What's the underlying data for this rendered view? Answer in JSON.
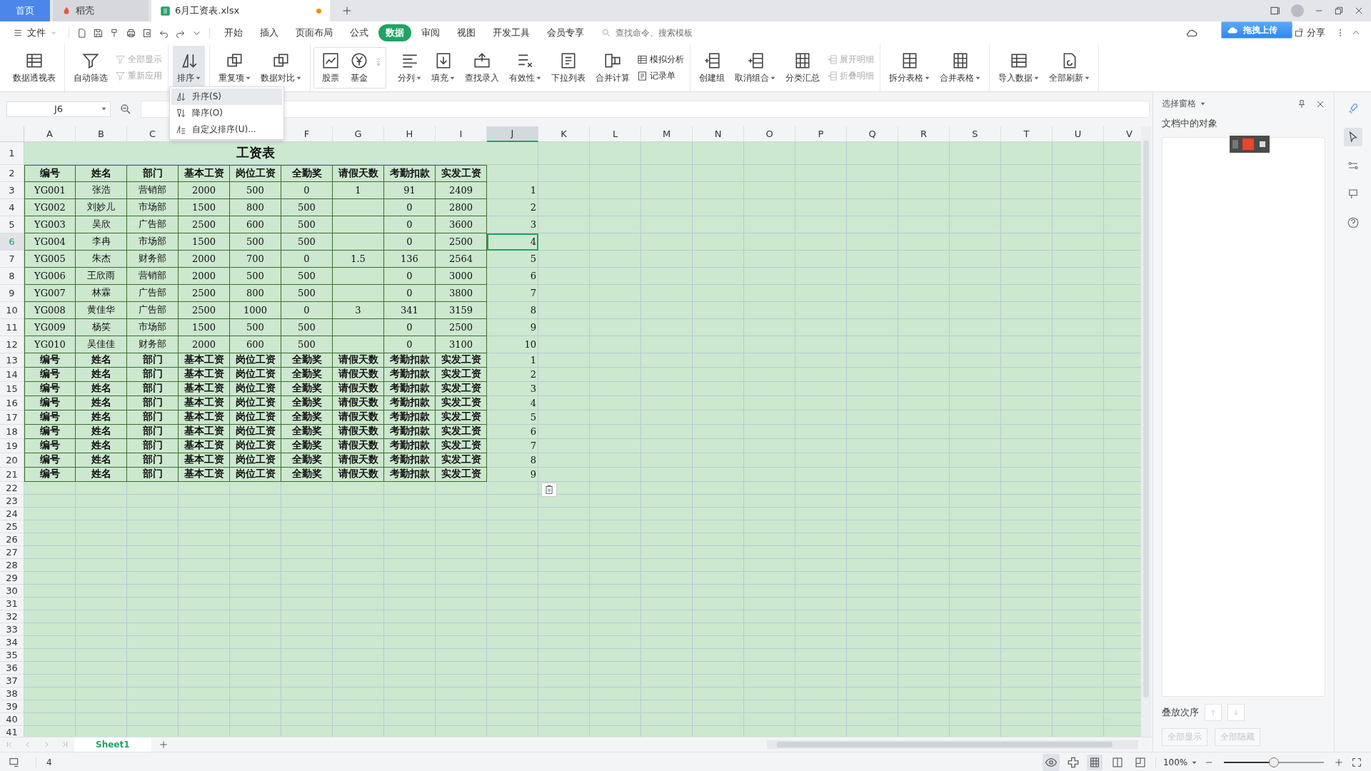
{
  "tabs": [
    {
      "label": "首页",
      "selected": false,
      "kind": "home",
      "modified": false
    },
    {
      "label": "稻壳",
      "selected": false,
      "kind": "app",
      "modified": false
    },
    {
      "label": "6月工资表.xlsx",
      "selected": true,
      "kind": "file",
      "modified": true
    }
  ],
  "menu": {
    "file_label": "文件",
    "tabs": [
      {
        "label": "开始",
        "selected": false
      },
      {
        "label": "插入",
        "selected": false
      },
      {
        "label": "页面布局",
        "selected": false
      },
      {
        "label": "公式",
        "selected": false
      },
      {
        "label": "数据",
        "selected": true
      },
      {
        "label": "审阅",
        "selected": false
      },
      {
        "label": "视图",
        "selected": false
      },
      {
        "label": "开发工具",
        "selected": false
      },
      {
        "label": "会员专享",
        "selected": false
      }
    ],
    "search": {
      "placeholder": "查找命令、搜索模板"
    },
    "share_label": "分享"
  },
  "upload_overlay": {
    "label": "拖拽上传"
  },
  "ribbon": {
    "groups": [
      {
        "kind": "plain",
        "items": [
          {
            "kind": "large",
            "label": "数据透视表",
            "dropdown": false,
            "disabled": false,
            "expanded": false
          }
        ]
      },
      {
        "kind": "plain",
        "items": [
          {
            "kind": "large",
            "label": "自动筛选",
            "dropdown": false,
            "disabled": false,
            "expanded": false
          },
          {
            "kind": "small",
            "label": "全部显示",
            "dropdown": false,
            "disabled": true,
            "expanded": false
          },
          {
            "kind": "small",
            "label": "重新应用",
            "dropdown": false,
            "disabled": true,
            "expanded": false
          }
        ]
      },
      {
        "kind": "plain",
        "items": [
          {
            "kind": "large",
            "label": "排序",
            "dropdown": true,
            "disabled": false,
            "expanded": true
          }
        ]
      },
      {
        "kind": "plain",
        "items": [
          {
            "kind": "large",
            "label": "重复项",
            "dropdown": true,
            "disabled": false,
            "expanded": false
          },
          {
            "kind": "large",
            "label": "数据对比",
            "dropdown": true,
            "disabled": false,
            "expanded": false
          }
        ]
      },
      {
        "kind": "gallery",
        "items": [
          {
            "kind": "large",
            "label": "股票",
            "dropdown": false,
            "disabled": false,
            "expanded": false
          },
          {
            "kind": "large",
            "label": "基金",
            "dropdown": false,
            "disabled": false,
            "expanded": false
          }
        ]
      },
      {
        "kind": "plain",
        "items": [
          {
            "kind": "large",
            "label": "分列",
            "dropdown": true,
            "disabled": false,
            "expanded": false
          },
          {
            "kind": "large",
            "label": "填充",
            "dropdown": true,
            "disabled": false,
            "expanded": false
          },
          {
            "kind": "large",
            "label": "查找录入",
            "dropdown": false,
            "disabled": false,
            "expanded": false
          },
          {
            "kind": "large",
            "label": "有效性",
            "dropdown": true,
            "disabled": false,
            "expanded": false
          },
          {
            "kind": "large",
            "label": "下拉列表",
            "dropdown": false,
            "disabled": false,
            "expanded": false
          },
          {
            "kind": "large",
            "label": "合并计算",
            "dropdown": false,
            "disabled": false,
            "expanded": false
          },
          {
            "kind": "small",
            "label": "模拟分析",
            "dropdown": false,
            "disabled": false,
            "expanded": false
          },
          {
            "kind": "small",
            "label": "记录单",
            "dropdown": false,
            "disabled": false,
            "expanded": false
          }
        ]
      },
      {
        "kind": "plain",
        "items": [
          {
            "kind": "large",
            "label": "创建组",
            "dropdown": false,
            "disabled": false,
            "expanded": false
          },
          {
            "kind": "large",
            "label": "取消组合",
            "dropdown": true,
            "disabled": false,
            "expanded": false
          },
          {
            "kind": "large",
            "label": "分类汇总",
            "dropdown": false,
            "disabled": false,
            "expanded": false
          },
          {
            "kind": "small",
            "label": "展开明细",
            "dropdown": false,
            "disabled": true,
            "expanded": false
          },
          {
            "kind": "small",
            "label": "折叠明细",
            "dropdown": false,
            "disabled": true,
            "expanded": false
          }
        ]
      },
      {
        "kind": "plain",
        "items": [
          {
            "kind": "large",
            "label": "拆分表格",
            "dropdown": true,
            "disabled": false,
            "expanded": false
          },
          {
            "kind": "large",
            "label": "合并表格",
            "dropdown": true,
            "disabled": false,
            "expanded": false
          }
        ]
      },
      {
        "kind": "plain",
        "items": [
          {
            "kind": "large",
            "label": "导入数据",
            "dropdown": true,
            "disabled": false,
            "expanded": false
          },
          {
            "kind": "large",
            "label": "全部刷新",
            "dropdown": true,
            "disabled": false,
            "expanded": false
          }
        ]
      }
    ]
  },
  "sort_menu": {
    "items": [
      {
        "label": "升序(S)",
        "selected": true
      },
      {
        "label": "降序(O)",
        "selected": false
      },
      {
        "label": "自定义排序(U)...",
        "selected": false
      }
    ]
  },
  "formula_bar": {
    "name_box": "J6"
  },
  "sheet": {
    "columns": [
      {
        "label": "A",
        "selected": false
      },
      {
        "label": "B",
        "selected": false
      },
      {
        "label": "C",
        "selected": false
      },
      {
        "selected": false
      },
      {
        "selected": false
      },
      {
        "label": "F",
        "selected": false
      },
      {
        "label": "G",
        "selected": false
      },
      {
        "label": "H",
        "selected": false
      },
      {
        "label": "I",
        "selected": false
      },
      {
        "label": "J",
        "selected": true
      },
      {
        "label": "K",
        "selected": false
      },
      {
        "label": "L",
        "selected": false
      },
      {
        "label": "M",
        "selected": false
      },
      {
        "label": "N",
        "selected": false
      },
      {
        "label": "O",
        "selected": false
      },
      {
        "label": "P",
        "selected": false
      },
      {
        "label": "Q",
        "selected": false
      },
      {
        "label": "R",
        "selected": false
      },
      {
        "label": "S",
        "selected": false
      },
      {
        "label": "T",
        "selected": false
      },
      {
        "label": "U",
        "selected": false
      },
      {
        "label": "V",
        "selected": false
      }
    ],
    "rows": [
      {
        "number": "1",
        "selected": false,
        "kind": "title",
        "cells": {
          "A": "工资表"
        }
      },
      {
        "number": "2",
        "selected": false,
        "kind": "header",
        "cells": {
          "A": "编号",
          "B": "姓名",
          "C": "部门",
          "D": "基本工资",
          "E": "岗位工资",
          "F": "全勤奖",
          "G": "请假天数",
          "H": "考勤扣款",
          "I": "实发工资"
        }
      },
      {
        "number": "3",
        "selected": false,
        "kind": "data",
        "cells": {
          "A": "YG001",
          "B": "张浩",
          "C": "营销部",
          "D": "2000",
          "E": "500",
          "F": "0",
          "G": "1",
          "H": "91",
          "I": "2409",
          "J": "1"
        }
      },
      {
        "number": "4",
        "selected": false,
        "kind": "data",
        "cells": {
          "A": "YG002",
          "B": "刘妙儿",
          "C": "市场部",
          "D": "1500",
          "E": "800",
          "F": "500",
          "H": "0",
          "I": "2800",
          "J": "2"
        }
      },
      {
        "number": "5",
        "selected": false,
        "kind": "data",
        "cells": {
          "A": "YG003",
          "B": "吴欣",
          "C": "广告部",
          "D": "2500",
          "E": "600",
          "F": "500",
          "H": "0",
          "I": "3600",
          "J": "3"
        }
      },
      {
        "number": "6",
        "selected": true,
        "kind": "data",
        "cells": {
          "A": "YG004",
          "B": "李冉",
          "C": "市场部",
          "D": "1500",
          "E": "500",
          "F": "500",
          "H": "0",
          "I": "2500",
          "J": "4"
        }
      },
      {
        "number": "7",
        "selected": false,
        "kind": "data",
        "cells": {
          "A": "YG005",
          "B": "朱杰",
          "C": "财务部",
          "D": "2000",
          "E": "700",
          "F": "0",
          "G": "1.5",
          "H": "136",
          "I": "2564",
          "J": "5"
        }
      },
      {
        "number": "8",
        "selected": false,
        "kind": "data",
        "cells": {
          "A": "YG006",
          "B": "王欣雨",
          "C": "营销部",
          "D": "2000",
          "E": "500",
          "F": "500",
          "H": "0",
          "I": "3000",
          "J": "6"
        }
      },
      {
        "number": "9",
        "selected": false,
        "kind": "data",
        "cells": {
          "A": "YG007",
          "B": "林霖",
          "C": "广告部",
          "D": "2500",
          "E": "800",
          "F": "500",
          "H": "0",
          "I": "3800",
          "J": "7"
        }
      },
      {
        "number": "10",
        "selected": false,
        "kind": "data",
        "cells": {
          "A": "YG008",
          "B": "黄佳华",
          "C": "广告部",
          "D": "2500",
          "E": "1000",
          "F": "0",
          "G": "3",
          "H": "341",
          "I": "3159",
          "J": "8"
        }
      },
      {
        "number": "11",
        "selected": false,
        "kind": "data",
        "cells": {
          "A": "YG009",
          "B": "杨笑",
          "C": "市场部",
          "D": "1500",
          "E": "500",
          "F": "500",
          "H": "0",
          "I": "2500",
          "J": "9"
        }
      },
      {
        "number": "12",
        "selected": false,
        "kind": "data",
        "cells": {
          "A": "YG010",
          "B": "吴佳佳",
          "C": "财务部",
          "D": "2000",
          "E": "600",
          "F": "500",
          "H": "0",
          "I": "3100",
          "J": "10"
        }
      },
      {
        "number": "13",
        "selected": false,
        "kind": "repeat",
        "cells": {
          "A": "编号",
          "B": "姓名",
          "C": "部门",
          "D": "基本工资",
          "E": "岗位工资",
          "F": "全勤奖",
          "G": "请假天数",
          "H": "考勤扣款",
          "I": "实发工资",
          "J": "1"
        }
      },
      {
        "number": "14",
        "selected": false,
        "kind": "repeat",
        "cells": {
          "A": "编号",
          "B": "姓名",
          "C": "部门",
          "D": "基本工资",
          "E": "岗位工资",
          "F": "全勤奖",
          "G": "请假天数",
          "H": "考勤扣款",
          "I": "实发工资",
          "J": "2"
        }
      },
      {
        "number": "15",
        "selected": false,
        "kind": "repeat",
        "cells": {
          "A": "编号",
          "B": "姓名",
          "C": "部门",
          "D": "基本工资",
          "E": "岗位工资",
          "F": "全勤奖",
          "G": "请假天数",
          "H": "考勤扣款",
          "I": "实发工资",
          "J": "3"
        }
      },
      {
        "number": "16",
        "selected": false,
        "kind": "repeat",
        "cells": {
          "A": "编号",
          "B": "姓名",
          "C": "部门",
          "D": "基本工资",
          "E": "岗位工资",
          "F": "全勤奖",
          "G": "请假天数",
          "H": "考勤扣款",
          "I": "实发工资",
          "J": "4"
        }
      },
      {
        "number": "17",
        "selected": false,
        "kind": "repeat",
        "cells": {
          "A": "编号",
          "B": "姓名",
          "C": "部门",
          "D": "基本工资",
          "E": "岗位工资",
          "F": "全勤奖",
          "G": "请假天数",
          "H": "考勤扣款",
          "I": "实发工资",
          "J": "5"
        }
      },
      {
        "number": "18",
        "selected": false,
        "kind": "repeat",
        "cells": {
          "A": "编号",
          "B": "姓名",
          "C": "部门",
          "D": "基本工资",
          "E": "岗位工资",
          "F": "全勤奖",
          "G": "请假天数",
          "H": "考勤扣款",
          "I": "实发工资",
          "J": "6"
        }
      },
      {
        "number": "19",
        "selected": false,
        "kind": "repeat",
        "cells": {
          "A": "编号",
          "B": "姓名",
          "C": "部门",
          "D": "基本工资",
          "E": "岗位工资",
          "F": "全勤奖",
          "G": "请假天数",
          "H": "考勤扣款",
          "I": "实发工资",
          "J": "7"
        }
      },
      {
        "number": "20",
        "selected": false,
        "kind": "repeat",
        "cells": {
          "A": "编号",
          "B": "姓名",
          "C": "部门",
          "D": "基本工资",
          "E": "岗位工资",
          "F": "全勤奖",
          "G": "请假天数",
          "H": "考勤扣款",
          "I": "实发工资",
          "J": "8"
        }
      },
      {
        "number": "21",
        "selected": false,
        "kind": "repeat",
        "cells": {
          "A": "编号",
          "B": "姓名",
          "C": "部门",
          "D": "基本工资",
          "E": "岗位工资",
          "F": "全勤奖",
          "G": "请假天数",
          "H": "考勤扣款",
          "I": "实发工资",
          "J": "9"
        }
      },
      {
        "number": "22",
        "selected": false,
        "kind": "empty"
      },
      {
        "number": "23",
        "selected": false,
        "kind": "empty"
      },
      {
        "number": "24",
        "selected": false,
        "kind": "empty"
      },
      {
        "number": "25",
        "selected": false,
        "kind": "empty"
      },
      {
        "number": "26",
        "selected": false,
        "kind": "empty"
      },
      {
        "number": "27",
        "selected": false,
        "kind": "empty"
      },
      {
        "number": "28",
        "selected": false,
        "kind": "empty"
      },
      {
        "number": "29",
        "selected": false,
        "kind": "empty"
      },
      {
        "number": "30",
        "selected": false,
        "kind": "empty"
      },
      {
        "number": "31",
        "selected": false,
        "kind": "empty"
      },
      {
        "number": "32",
        "selected": false,
        "kind": "empty"
      },
      {
        "number": "33",
        "selected": false,
        "kind": "empty"
      },
      {
        "number": "34",
        "selected": false,
        "kind": "empty"
      },
      {
        "number": "35",
        "selected": false,
        "kind": "empty"
      },
      {
        "number": "36",
        "selected": false,
        "kind": "empty"
      },
      {
        "number": "37",
        "selected": false,
        "kind": "empty"
      },
      {
        "number": "38",
        "selected": false,
        "kind": "empty"
      },
      {
        "number": "39",
        "selected": false,
        "kind": "empty"
      },
      {
        "number": "40",
        "selected": false,
        "kind": "empty"
      },
      {
        "number": "41",
        "selected": false,
        "kind": "empty"
      }
    ]
  },
  "sheet_tabs": [
    {
      "label": "Sheet1",
      "selected": true
    }
  ],
  "selection_pane": {
    "title": "选择窗格",
    "objects_label": "文档中的对象",
    "order_label": "叠放次序",
    "buttons": [
      {
        "label": "全部显示",
        "disabled": true
      },
      {
        "label": "全部隐藏",
        "disabled": true
      }
    ]
  },
  "status_bar": {
    "value": "4",
    "reading_mode": {
      "on": true
    },
    "view_modes": [
      {
        "selected": true
      },
      {
        "selected": false
      },
      {
        "selected": false
      }
    ],
    "zoom": "100%",
    "zoom_slider": {
      "level": 0.5
    }
  }
}
